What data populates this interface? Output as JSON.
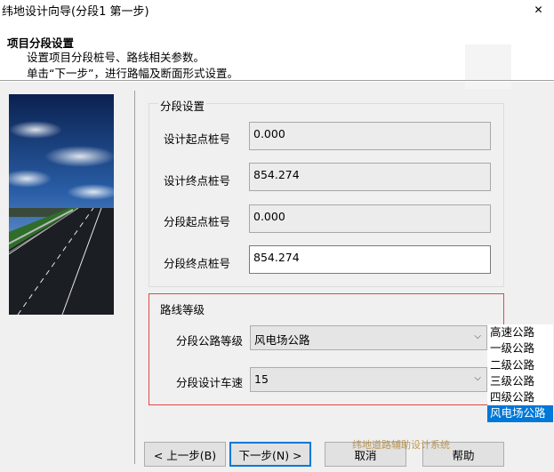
{
  "window": {
    "title": "纬地设计向导(分段1 第一步)",
    "close_glyph": "✕"
  },
  "header": {
    "title": "项目分段设置",
    "desc_line1": "设置项目分段桩号、路线相关参数。",
    "desc_line2": "单击“下一步”，进行路幅及断面形式设置。"
  },
  "segment_group": {
    "legend": "分段设置",
    "fields": [
      {
        "label": "设计起点桩号",
        "value": "0.000",
        "editable": false
      },
      {
        "label": "设计终点桩号",
        "value": "854.274",
        "editable": false
      },
      {
        "label": "分段起点桩号",
        "value": "0.000",
        "editable": false
      },
      {
        "label": "分段终点桩号",
        "value": "854.274",
        "editable": true
      }
    ]
  },
  "route_group": {
    "legend": "路线等级",
    "grade_label": "分段公路等级",
    "grade_value": "风电场公路",
    "speed_label": "分段设计车速",
    "speed_value": "15",
    "dropdown_glyph": "⌵"
  },
  "grade_options": {
    "items": [
      "高速公路",
      "一级公路",
      "二级公路",
      "三级公路",
      "四级公路",
      "风电场公路"
    ],
    "selected_index": 5,
    "selected_color": "#0078d7"
  },
  "buttons": {
    "prev": "< 上一步(B)",
    "next": "下一步(N) >",
    "cancel": "取消",
    "help": "帮助"
  },
  "watermark": "纬地道路辅助设计系统",
  "colors": {
    "highlight_border": "#e04848",
    "accent": "#0078d7"
  }
}
